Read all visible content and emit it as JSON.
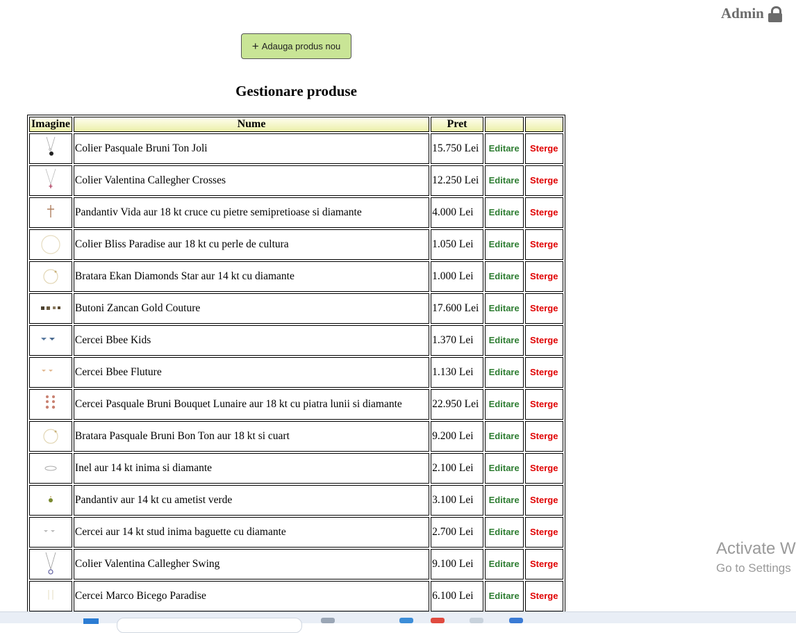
{
  "header": {
    "user_label": "Admin"
  },
  "toolbar": {
    "add_label": "Adauga produs nou"
  },
  "page_title": "Gestionare produse",
  "table": {
    "columns": [
      "Imagine",
      "Nume",
      "Pret",
      "",
      ""
    ],
    "rows": [
      {
        "name": "Colier Pasquale Bruni Ton Joli",
        "price": "15.750 Lei",
        "edit": "Editare",
        "delete": "Sterge",
        "thumb": "necklace"
      },
      {
        "name": "Colier Valentina Callegher Crosses",
        "price": "12.250 Lei",
        "edit": "Editare",
        "delete": "Sterge",
        "thumb": "necklace-cross"
      },
      {
        "name": "Pandantiv Vida aur 18 kt cruce cu pietre semipretioase si diamante",
        "price": "4.000 Lei",
        "edit": "Editare",
        "delete": "Sterge",
        "thumb": "cross"
      },
      {
        "name": "Colier Bliss Paradise aur 18 kt cu perle de cultura",
        "price": "1.050 Lei",
        "edit": "Editare",
        "delete": "Sterge",
        "thumb": "chain-circle"
      },
      {
        "name": "Bratara Ekan Diamonds Star aur 14 kt cu diamante",
        "price": "1.000 Lei",
        "edit": "Editare",
        "delete": "Sterge",
        "thumb": "bracelet"
      },
      {
        "name": "Butoni Zancan Gold Couture",
        "price": "17.600 Lei",
        "edit": "Editare",
        "delete": "Sterge",
        "thumb": "cufflinks"
      },
      {
        "name": "Cercei Bbee Kids",
        "price": "1.370 Lei",
        "edit": "Editare",
        "delete": "Sterge",
        "thumb": "earrings-blue"
      },
      {
        "name": "Cercei Bbee Fluture",
        "price": "1.130 Lei",
        "edit": "Editare",
        "delete": "Sterge",
        "thumb": "earrings-butterfly"
      },
      {
        "name": "Cercei Pasquale Bruni Bouquet Lunaire aur 18 kt cu piatra lunii si diamante",
        "price": "22.950 Lei",
        "edit": "Editare",
        "delete": "Sterge",
        "thumb": "earrings-drop"
      },
      {
        "name": "Bratara Pasquale Bruni Bon Ton aur 18 kt si cuart",
        "price": "9.200 Lei",
        "edit": "Editare",
        "delete": "Sterge",
        "thumb": "bracelet"
      },
      {
        "name": "Inel aur 14 kt inima si diamante",
        "price": "2.100 Lei",
        "edit": "Editare",
        "delete": "Sterge",
        "thumb": "ring"
      },
      {
        "name": "Pandantiv aur 14 kt cu ametist verde",
        "price": "3.100 Lei",
        "edit": "Editare",
        "delete": "Sterge",
        "thumb": "pendant-green"
      },
      {
        "name": "Cercei aur 14 kt stud inima baguette cu diamante",
        "price": "2.700 Lei",
        "edit": "Editare",
        "delete": "Sterge",
        "thumb": "studs"
      },
      {
        "name": "Colier Valentina Callegher Swing",
        "price": "9.100 Lei",
        "edit": "Editare",
        "delete": "Sterge",
        "thumb": "necklace-pendant"
      },
      {
        "name": "Cercei Marco Bicego Paradise",
        "price": "6.100 Lei",
        "edit": "Editare",
        "delete": "Sterge",
        "thumb": "earrings-line"
      }
    ]
  },
  "watermark": {
    "line1": "Activate W",
    "line2": "Go to Settings"
  },
  "colors": {
    "add_button": "#c9e596",
    "edit_link": "#2e7d32",
    "delete_link": "#e00000",
    "header_gradient_end": "#ecf0a9"
  },
  "icons": {
    "user_lock": "lock-icon",
    "add": "plus-icon"
  }
}
